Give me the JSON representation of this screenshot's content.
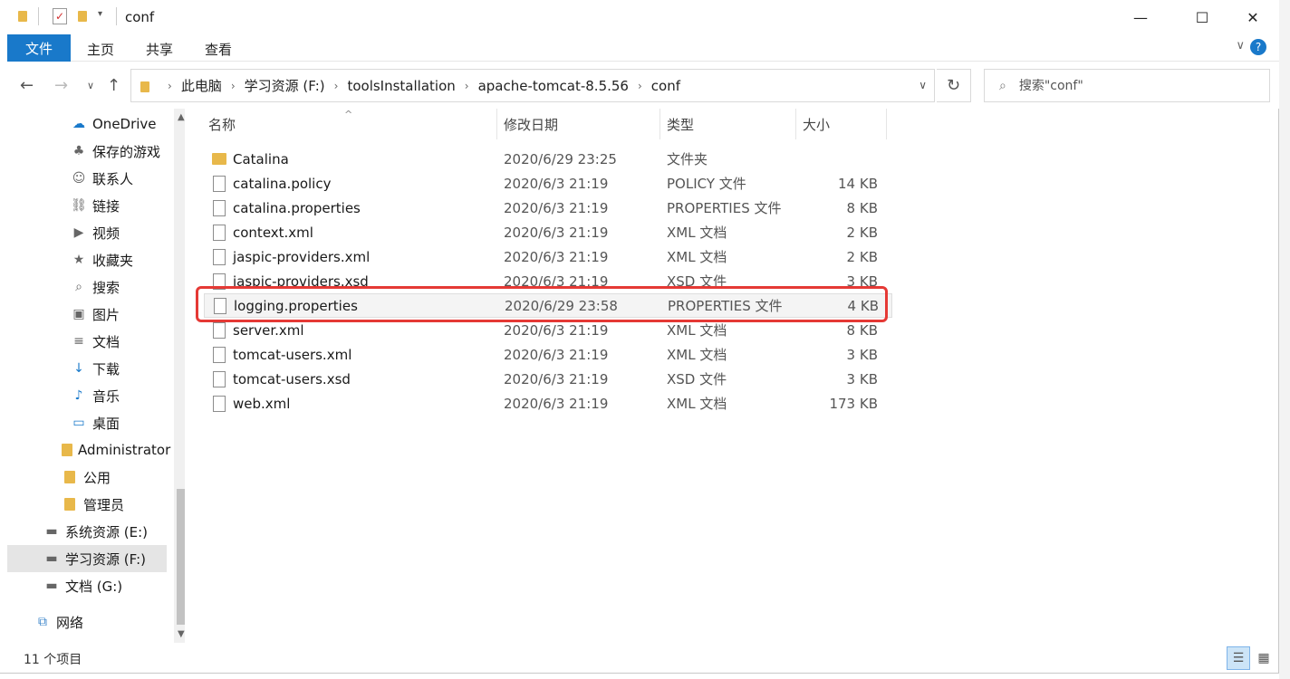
{
  "window": {
    "title": "conf"
  },
  "ribbon": {
    "file": "文件",
    "tabs": [
      "主页",
      "共享",
      "查看"
    ]
  },
  "address": {
    "crumbs": [
      "此电脑",
      "学习资源 (F:)",
      "toolsInstallation",
      "apache-tomcat-8.5.56",
      "conf"
    ],
    "search_placeholder": "搜索\"conf\""
  },
  "nav": [
    {
      "label": "OneDrive",
      "icon": "cloud-icon",
      "indent": 70
    },
    {
      "label": "保存的游戏",
      "icon": "games-icon",
      "indent": 70
    },
    {
      "label": "联系人",
      "icon": "contacts-icon",
      "indent": 70
    },
    {
      "label": "链接",
      "icon": "links-icon",
      "indent": 70
    },
    {
      "label": "视频",
      "icon": "video-icon",
      "indent": 70
    },
    {
      "label": "收藏夹",
      "icon": "favorites-icon",
      "indent": 70
    },
    {
      "label": "搜索",
      "icon": "search-folder-icon",
      "indent": 70
    },
    {
      "label": "图片",
      "icon": "pictures-icon",
      "indent": 70
    },
    {
      "label": "文档",
      "icon": "documents-icon",
      "indent": 70
    },
    {
      "label": "下载",
      "icon": "download-icon",
      "indent": 70
    },
    {
      "label": "音乐",
      "icon": "music-icon",
      "indent": 70
    },
    {
      "label": "桌面",
      "icon": "desktop-icon",
      "indent": 70
    },
    {
      "label": "Administrator",
      "icon": "folder-icon",
      "indent": 60
    },
    {
      "label": "公用",
      "icon": "folder-icon",
      "indent": 60
    },
    {
      "label": "管理员",
      "icon": "folder-icon",
      "indent": 60
    },
    {
      "label": "系统资源 (E:)",
      "icon": "drive-icon",
      "indent": 40
    },
    {
      "label": "学习资源 (F:)",
      "icon": "drive-icon",
      "indent": 40,
      "selected": true
    },
    {
      "label": "文档 (G:)",
      "icon": "drive-icon",
      "indent": 40
    },
    {
      "label": "网络",
      "icon": "network-icon",
      "indent": 30
    }
  ],
  "columns": {
    "name": "名称",
    "date": "修改日期",
    "type": "类型",
    "size": "大小"
  },
  "files": [
    {
      "name": "Catalina",
      "date": "2020/6/29 23:25",
      "type": "文件夹",
      "size": "",
      "folder": true
    },
    {
      "name": "catalina.policy",
      "date": "2020/6/3 21:19",
      "type": "POLICY 文件",
      "size": "14 KB"
    },
    {
      "name": "catalina.properties",
      "date": "2020/6/3 21:19",
      "type": "PROPERTIES 文件",
      "size": "8 KB"
    },
    {
      "name": "context.xml",
      "date": "2020/6/3 21:19",
      "type": "XML 文档",
      "size": "2 KB"
    },
    {
      "name": "jaspic-providers.xml",
      "date": "2020/6/3 21:19",
      "type": "XML 文档",
      "size": "2 KB"
    },
    {
      "name": "jaspic-providers.xsd",
      "date": "2020/6/3 21:19",
      "type": "XSD 文件",
      "size": "3 KB"
    },
    {
      "name": "logging.properties",
      "date": "2020/6/29 23:58",
      "type": "PROPERTIES 文件",
      "size": "4 KB",
      "highlighted": true
    },
    {
      "name": "server.xml",
      "date": "2020/6/3 21:19",
      "type": "XML 文档",
      "size": "8 KB"
    },
    {
      "name": "tomcat-users.xml",
      "date": "2020/6/3 21:19",
      "type": "XML 文档",
      "size": "3 KB"
    },
    {
      "name": "tomcat-users.xsd",
      "date": "2020/6/3 21:19",
      "type": "XSD 文件",
      "size": "3 KB"
    },
    {
      "name": "web.xml",
      "date": "2020/6/3 21:19",
      "type": "XML 文档",
      "size": "173 KB"
    }
  ],
  "status": {
    "count": "11 个项目"
  },
  "colors": {
    "accent": "#1979ca",
    "highlight_border": "#e53935",
    "folder": "#e8b84a"
  }
}
